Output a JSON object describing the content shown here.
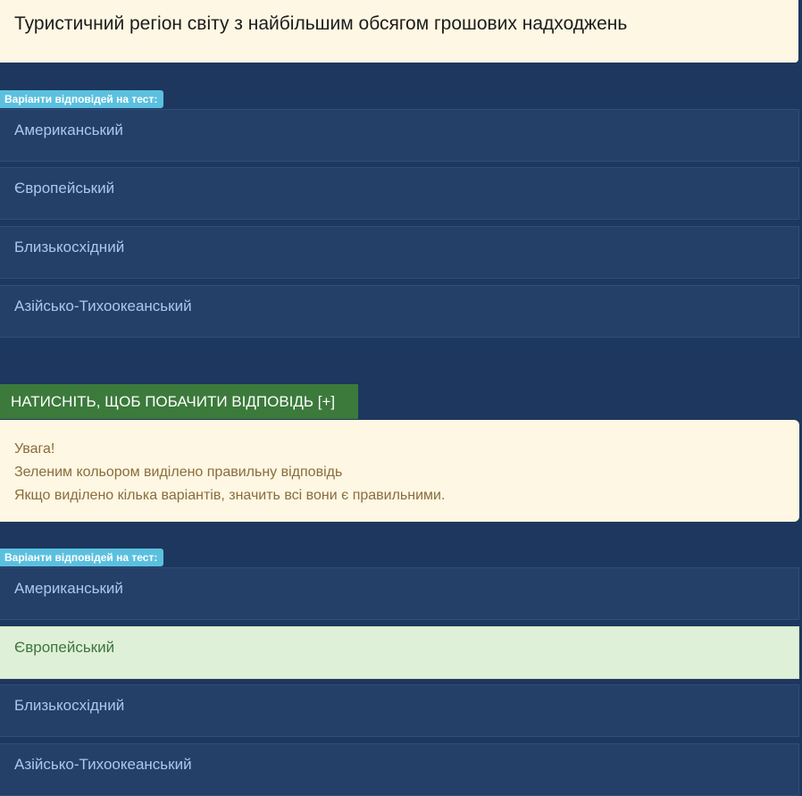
{
  "question": {
    "text": "Туристичний регіон світу з найбільшим обсягом грошових надходжень"
  },
  "answers_block_1": {
    "badge": "Варіанти відповідей на тест:",
    "options": [
      "Американський",
      "Європейський",
      "Близькосхідний",
      "Азійсько-Тихоокеанський"
    ]
  },
  "reveal_button": {
    "label": "НАТИСНІТЬ, ЩОБ ПОБАЧИТИ ВІДПОВІДЬ [+]"
  },
  "notice": {
    "title": "Увага!",
    "line1": "Зеленим кольором виділено правильну відповідь",
    "line2": "Якщо виділено кілька варіантів, значить всі вони є правильними."
  },
  "answers_block_2": {
    "badge": "Варіанти відповідей на тест:",
    "options": [
      "Американський",
      "Європейський",
      "Близькосхідний",
      "Азійсько-Тихоокеанський"
    ],
    "correct_option": "Європейський"
  },
  "colors": {
    "background": "#1e375e",
    "option_background": "#244069",
    "option_text": "#a9c7ef",
    "badge": "#5bc0de",
    "reveal_button": "#3b7a3b",
    "notice_background": "#fdf7e3",
    "notice_text": "#8a6d3b",
    "correct_background": "#dff0d8",
    "correct_text": "#3c763d"
  }
}
